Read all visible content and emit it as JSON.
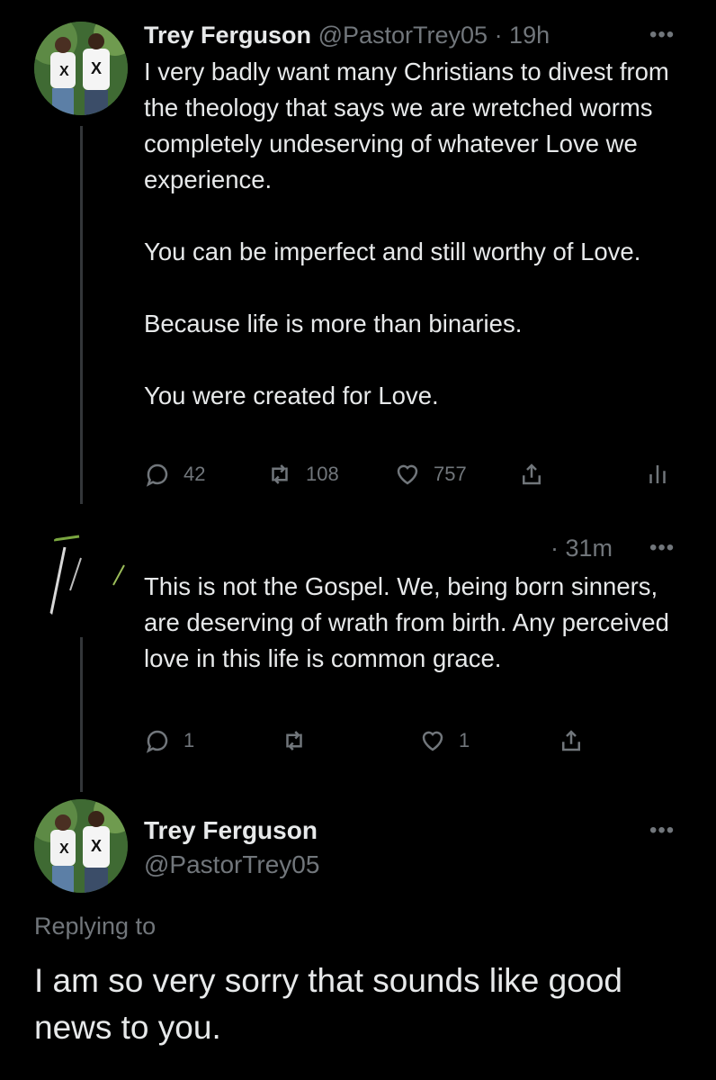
{
  "tweet1": {
    "name": "Trey Ferguson",
    "handle": "@PastorTrey05",
    "time": "· 19h",
    "text": "I very badly want many Christians to divest from the theology that says we are wretched worms completely undeserving of whatever Love we experience.\n\nYou can be imperfect and still worthy of Love.\n\nBecause life is more than binaries.\n\nYou were created for Love.",
    "replies": "42",
    "retweets": "108",
    "likes": "757"
  },
  "tweet2": {
    "time": "· 31m",
    "text": "This is not the Gospel. We, being born sinners, are deserving of wrath from birth. Any perceived love in this life is common grace.",
    "replies": "1",
    "likes": "1"
  },
  "tweet3": {
    "name": "Trey Ferguson",
    "handle": "@PastorTrey05",
    "replying_to": "Replying to",
    "text": "I am so very sorry that sounds like good news to you."
  },
  "icons": {
    "more": "more-icon",
    "reply": "reply-icon",
    "retweet": "retweet-icon",
    "like": "heart-icon",
    "share": "share-icon",
    "analytics": "analytics-icon"
  },
  "colors": {
    "background": "#000000",
    "text": "#e7e9ea",
    "muted": "#71767b",
    "line": "#333639"
  }
}
